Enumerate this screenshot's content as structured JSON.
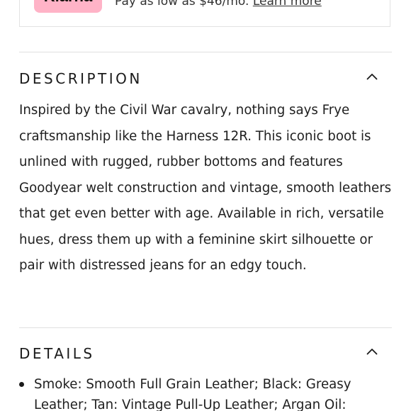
{
  "klarna": {
    "badge": "Klarna",
    "text": "Pay as low as $46/mo.",
    "link": "Learn more"
  },
  "description": {
    "title": "DESCRIPTION",
    "icon": "chevron-up-icon",
    "body": "Inspired by the Civil War cavalry, nothing says Frye craftsmanship like the Harness 12R. This iconic boot is unlined with rugged, rubber bottoms and features Goodyear welt construction and vintage, smooth leathers that get even better with age. Available in rich, versatile hues, dress them up with a feminine skirt silhouette or pair with distressed jeans for an edgy touch."
  },
  "details": {
    "title": "DETAILS",
    "icon": "chevron-up-icon",
    "items": [
      "Smoke: Smooth Full Grain Leather; Black: Greasy Leather; Tan: Vintage Pull-Up Leather; Argan Oil:"
    ]
  }
}
